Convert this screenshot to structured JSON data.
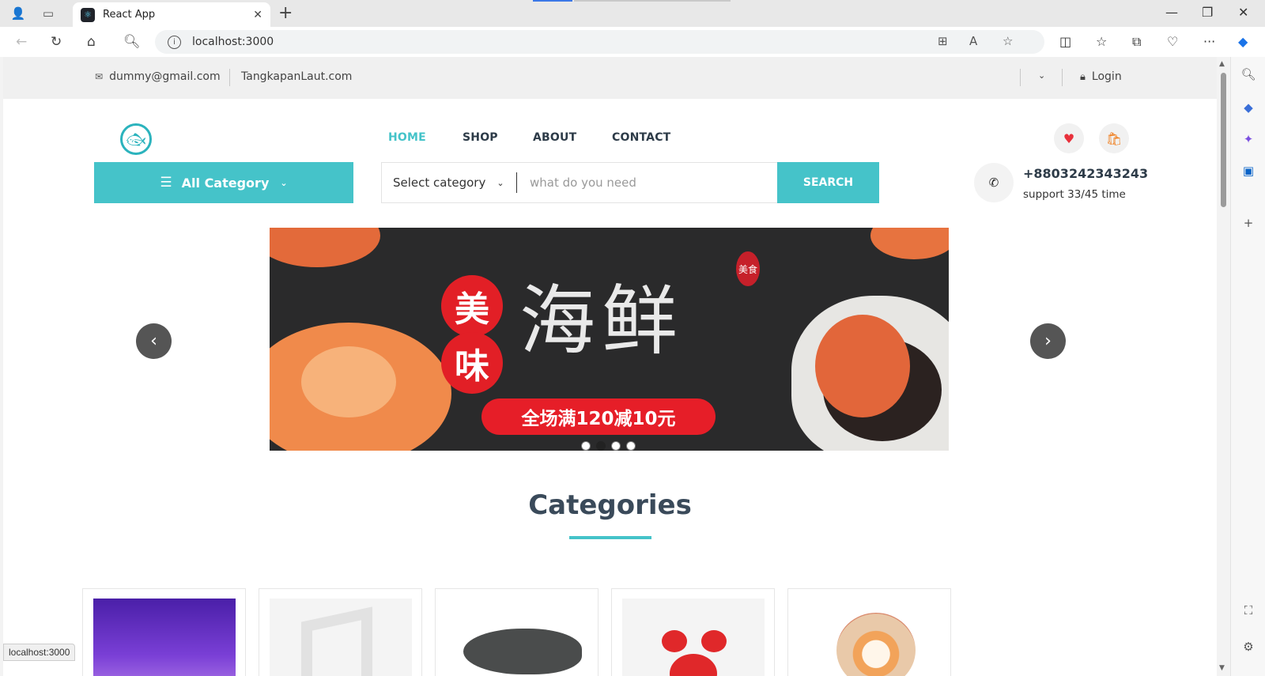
{
  "browser": {
    "tab_title": "React App",
    "url": "localhost:3000",
    "status_url": "localhost:3000"
  },
  "topbar": {
    "email": "dummy@gmail.com",
    "site": "TangkapanLaut.com",
    "login": "Login"
  },
  "nav": {
    "items": [
      "HOME",
      "SHOP",
      "ABOUT",
      "CONTACT"
    ],
    "active": "HOME"
  },
  "search": {
    "all_category": "All Category",
    "select_category": "Select category",
    "placeholder": "what do you need",
    "button": "SEARCH"
  },
  "contact": {
    "phone": "+8803242343243",
    "support": "support 33/45 time"
  },
  "hero": {
    "seal_top": "美",
    "seal_bottom": "味",
    "big_text": "海鲜",
    "stamp": "美食",
    "promo": "全场满120减10元",
    "slides_total": 4,
    "active_slide": 2
  },
  "categories": {
    "heading": "Categories"
  },
  "colors": {
    "accent": "#45c3c9",
    "nav_text": "#2d3b48",
    "promo_red": "#e61e28"
  }
}
